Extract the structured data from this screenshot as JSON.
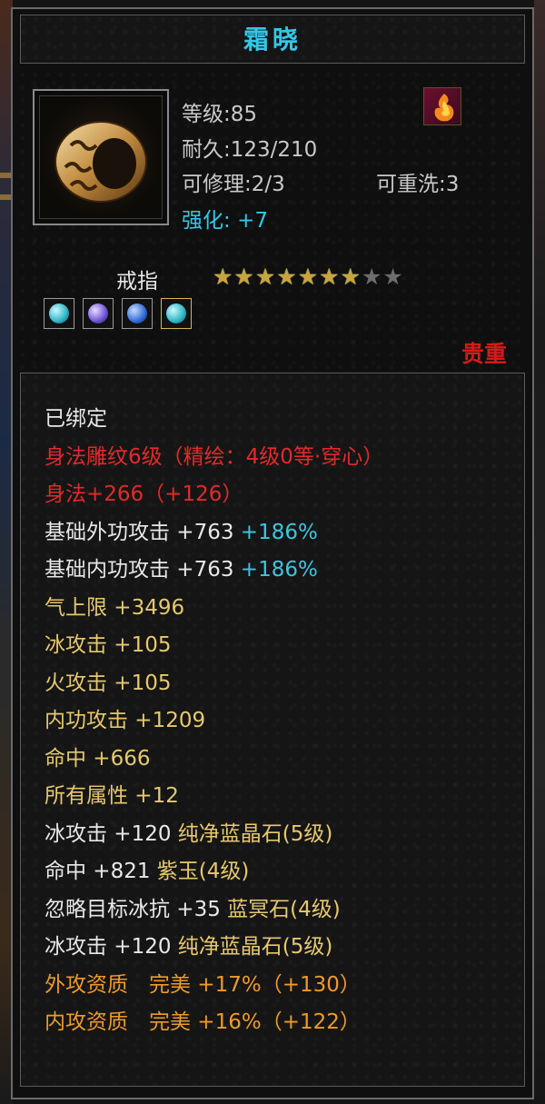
{
  "item": {
    "name": "霜晓",
    "level_label": "等级:85",
    "durability_label": "耐久:123/210",
    "repair_label": "可修理:2/3",
    "rewash_label": "可重洗:3",
    "enhance_label": "强化:",
    "enhance_value": "+7",
    "type": "戒指",
    "stars_total": 9,
    "stars_filled": 7,
    "rarity": "贵重",
    "gems": [
      "ice-gem-icon",
      "purple-gem-icon",
      "blue-gem-icon",
      "ice-gem-icon"
    ]
  },
  "stats": {
    "bound": "已绑定",
    "carve": "身法雕纹6级（精绘：4级0等·穿心）",
    "agility": "身法+266（+126）",
    "ext_attack": "基础外功攻击 +763",
    "ext_attack_pct": "+186%",
    "int_attack": "基础内功攻击 +763",
    "int_attack_pct": "+186%",
    "hp_max": "气上限 +3496",
    "ice_attack": "冰攻击 +105",
    "fire_attack": "火攻击 +105",
    "inner_attack": "内功攻击 +1209",
    "hit": "命中 +666",
    "all_attrs": "所有属性 +12",
    "socket1_stat": "冰攻击 +120",
    "socket1_gem": "纯净蓝晶石(5级)",
    "socket2_stat": "命中 +821",
    "socket2_gem": "紫玉(4级)",
    "socket3_stat": "忽略目标冰抗 +35",
    "socket3_gem": "蓝冥石(4级)",
    "socket4_stat": "冰攻击 +120",
    "socket4_gem": "纯净蓝晶石(5级)",
    "ext_quality": "外攻资质　完美 +17%（+130）",
    "int_quality": "内攻资质　完美 +16%（+122）"
  },
  "colors": {
    "title_cyan": "#35c7e6",
    "rarity_red": "#d21b1b",
    "star_gold": "#c7a43c",
    "stat_yellow": "#e6c86e",
    "quality_orange": "#ee9a2b"
  }
}
